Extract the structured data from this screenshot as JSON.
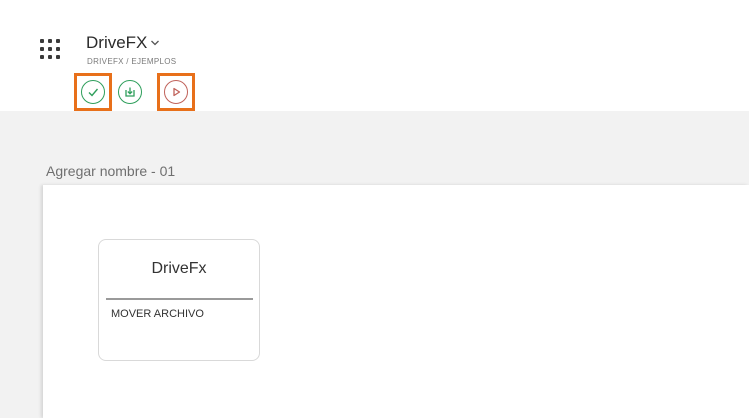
{
  "app": {
    "title": "DriveFX",
    "breadcrumb": "DRIVEFX / EJEMPLOS"
  },
  "toolbar": {
    "buttons": [
      {
        "name": "check",
        "icon": "check-icon",
        "color": "#2e9e5b",
        "highlighted": true
      },
      {
        "name": "download",
        "icon": "download-icon",
        "color": "#2e9e5b",
        "highlighted": false
      },
      {
        "name": "play",
        "icon": "play-icon",
        "color": "#c0625a",
        "highlighted": true
      }
    ],
    "highlight_color": "#e8701a"
  },
  "section": {
    "title": "Agregar nombre - 01"
  },
  "card": {
    "title": "DriveFx",
    "action": "MOVER ARCHIVO"
  }
}
